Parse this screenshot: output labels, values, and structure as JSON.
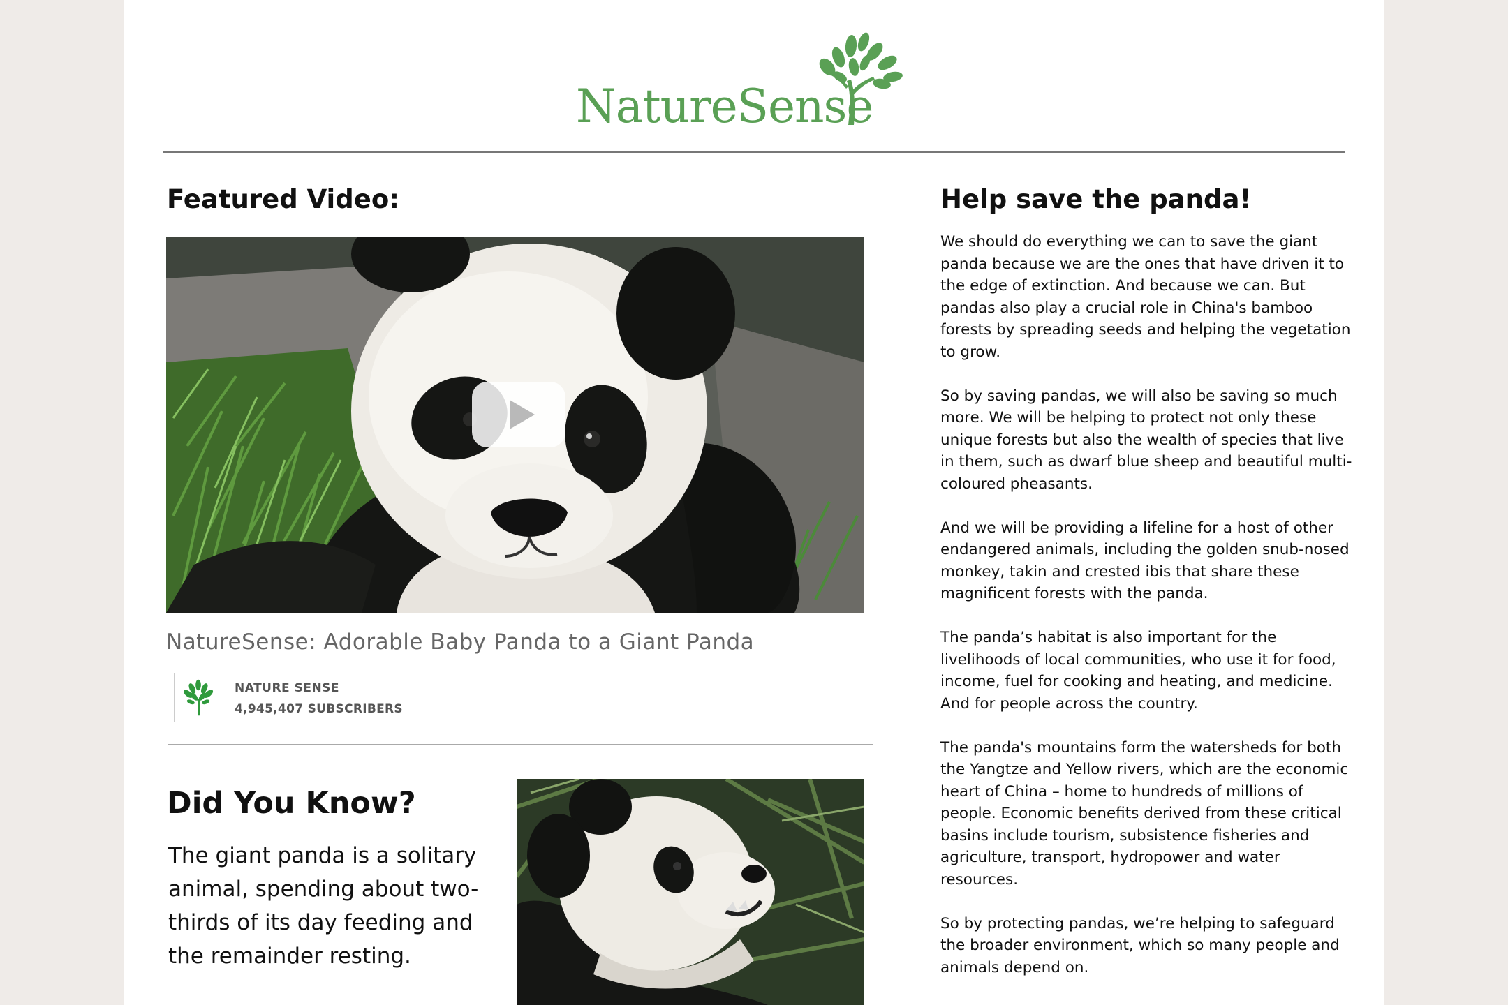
{
  "brand": {
    "name": "NatureSense",
    "color": "#5aa055"
  },
  "featured": {
    "heading": "Featured Video:",
    "video_title": "NatureSense: Adorable Baby Panda to a Giant Panda",
    "channel_name": "NATURE SENSE",
    "subscribers": "4,945,407 SUBSCRIBERS"
  },
  "did_you_know": {
    "heading": "Did You Know?",
    "text": "The giant panda is a solitary animal, spending about two-thirds of its day feeding and the remainder resting."
  },
  "help": {
    "heading": "Help save the panda!",
    "paragraphs": [
      "We should do everything we can to save the giant panda because we are the ones that have driven it to the edge of extinction. And because we can. But pandas also play a crucial role in China's bamboo forests by spreading seeds and helping the vegetation to grow.",
      "So by saving pandas, we will also be saving so much more. We will be helping to protect not only these unique forests but also the wealth of species that live in them, such as dwarf blue sheep and beautiful multi-coloured pheasants.",
      "And we will be providing a lifeline for a host of other endangered animals, including the golden snub-nosed monkey, takin and crested ibis that share these magnificent forests with the panda.",
      "The panda’s habitat is also important for the livelihoods of local communities, who use it for food, income, fuel for cooking and heating, and medicine. And for people across the country.",
      "The panda's mountains form the watersheds for both the Yangtze and Yellow rivers, which are the economic heart of China – home to hundreds of millions of people. Economic benefits derived from these critical basins include tourism, subsistence fisheries and agriculture, transport, hydropower and water resources.",
      "So by protecting pandas, we’re helping to safeguard the broader environment, which so many people and animals depend on."
    ]
  },
  "icons": {
    "logo": "tree-logo-icon",
    "play": "play-icon",
    "avatar": "tree-avatar-icon"
  }
}
